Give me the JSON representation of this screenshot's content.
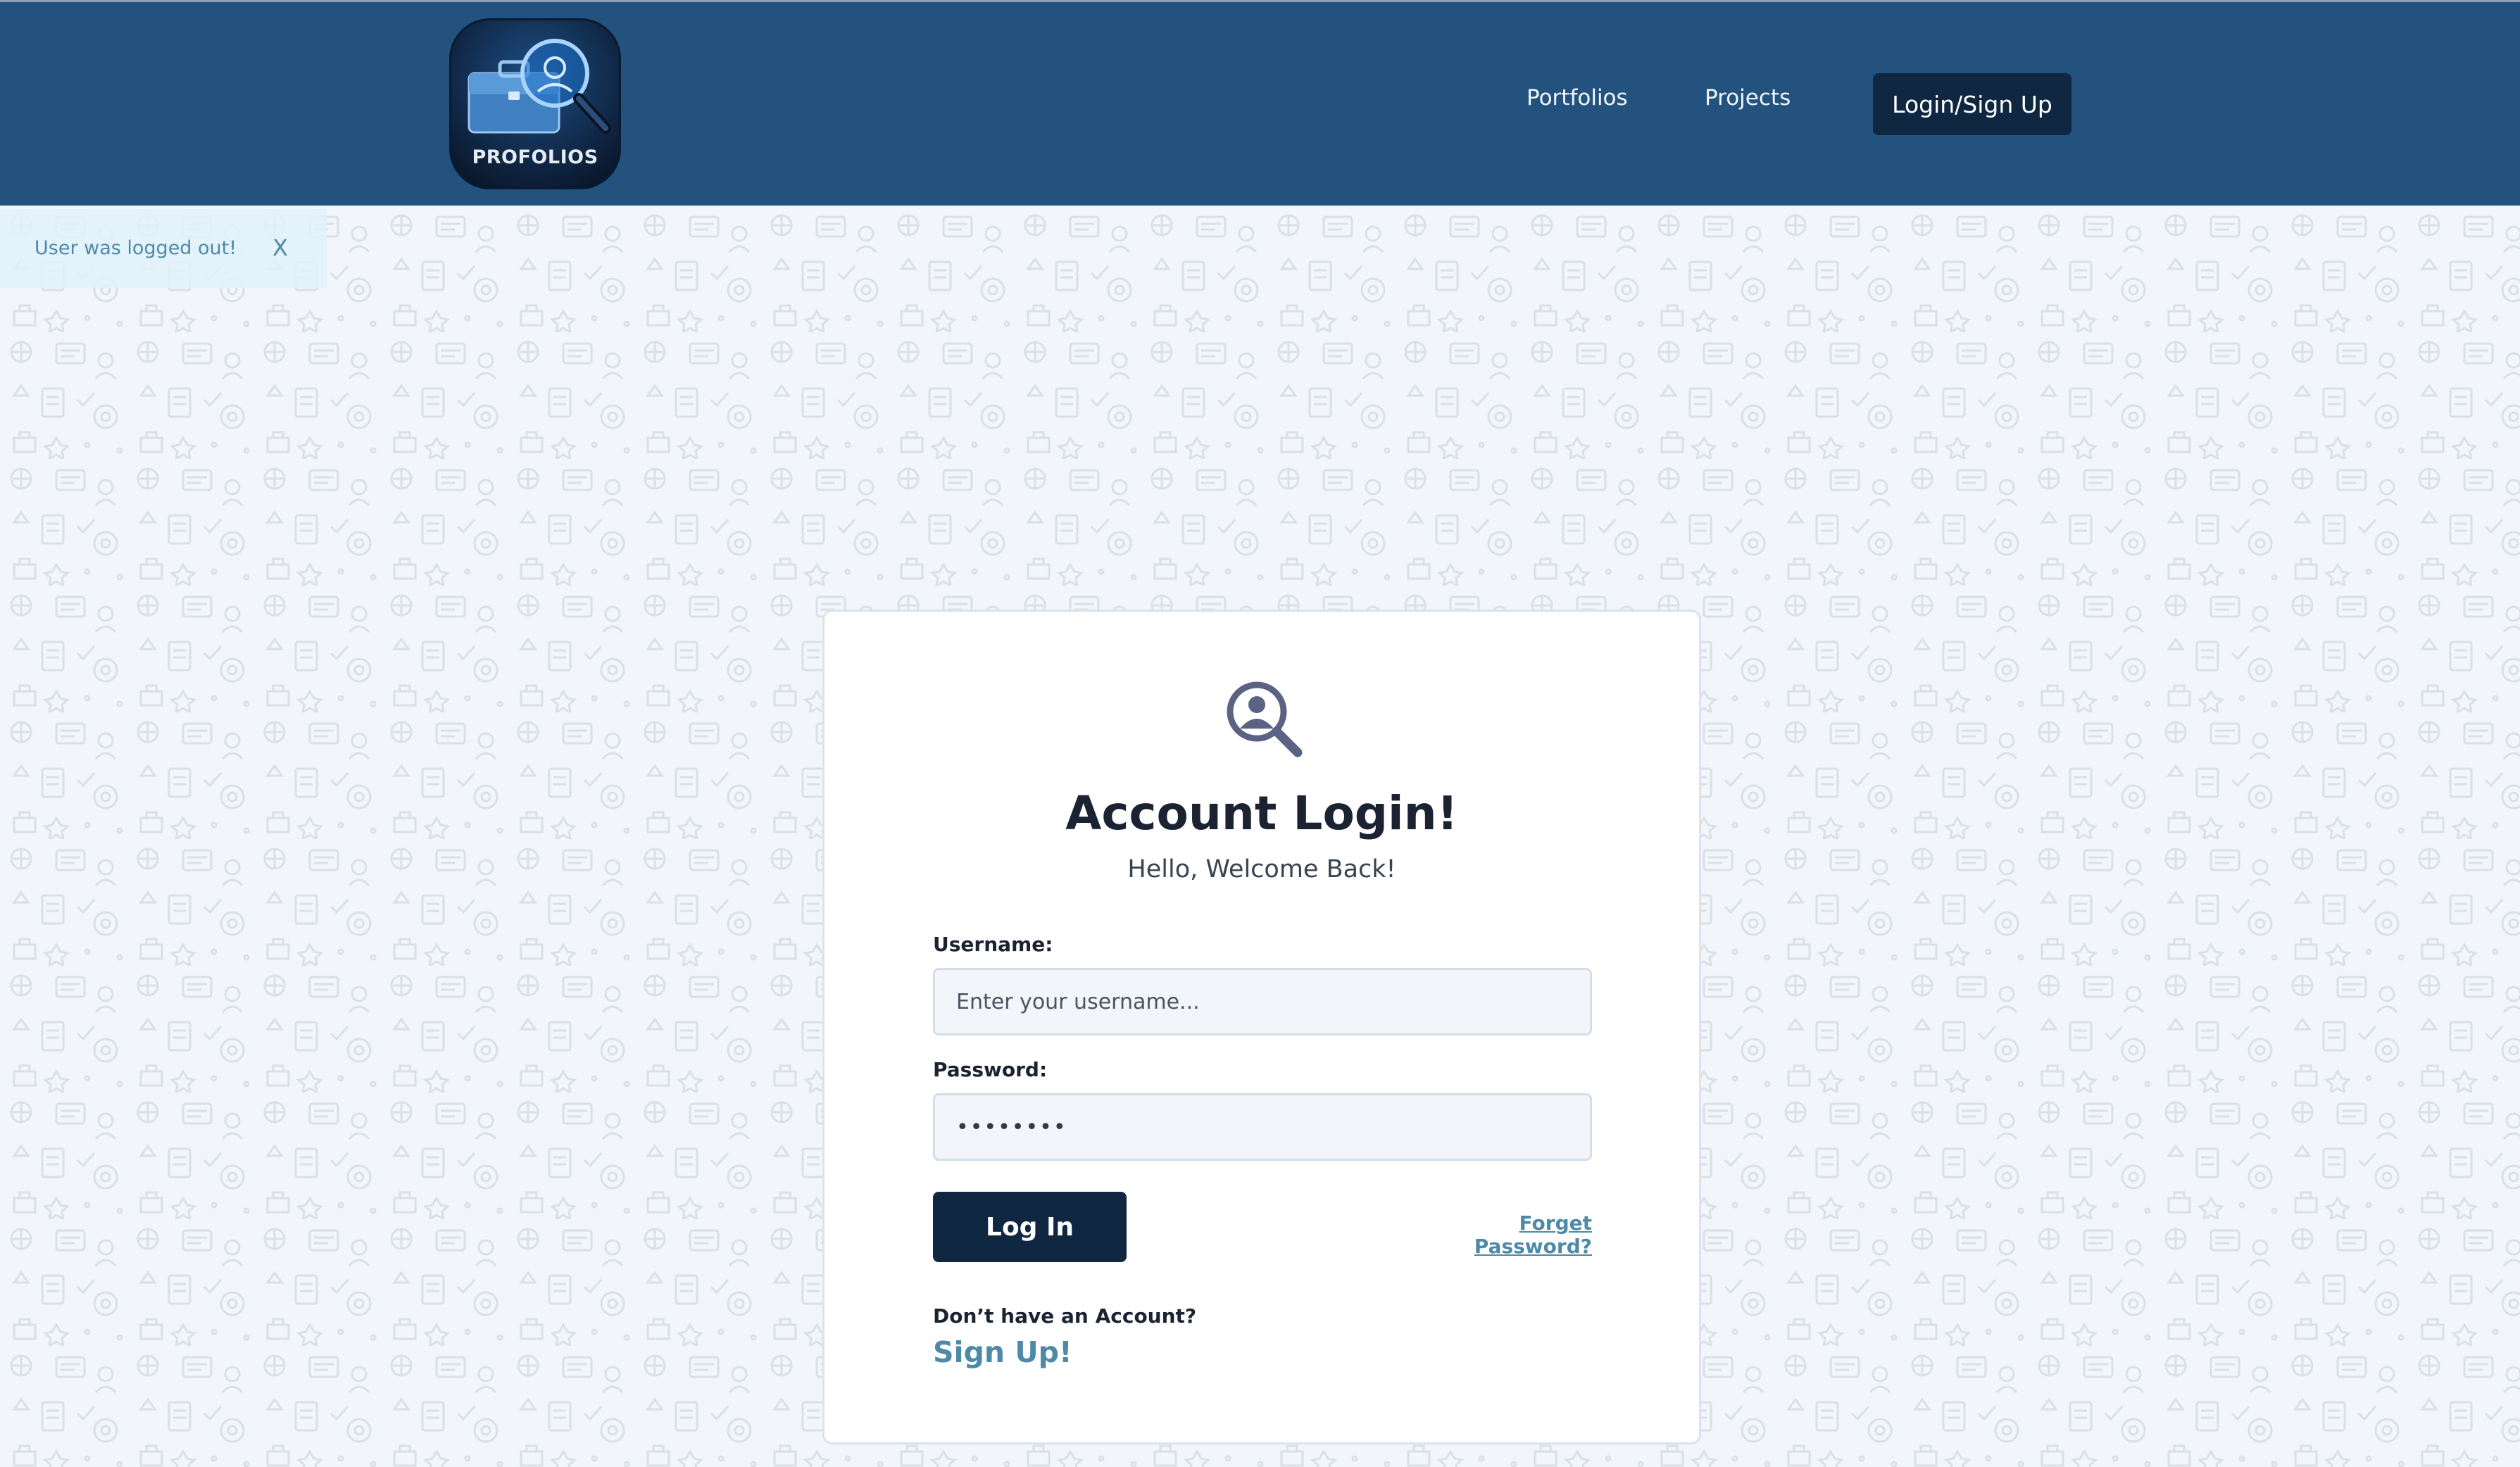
{
  "header": {
    "logo_text": "PROFOLIOS",
    "logo_icon": "briefcase-magnifier-icon",
    "nav": {
      "portfolios_label": "Portfolios",
      "projects_label": "Projects",
      "login_signup_label": "Login/Sign Up"
    }
  },
  "flash": {
    "message": "User was logged out!",
    "close_label": "X"
  },
  "login": {
    "icon": "user-search-icon",
    "title": "Account Login!",
    "subtitle": "Hello, Welcome Back!",
    "username_label": "Username:",
    "username_placeholder": "Enter your username...",
    "username_value": "",
    "password_label": "Password:",
    "password_value": "••••••••",
    "submit_label": "Log In",
    "forgot_label": "Forget Password?",
    "no_account_text": "Don’t have an Account?",
    "signup_label": "Sign Up!"
  },
  "colors": {
    "header_bg": "#23527f",
    "button_dark": "#0f2741",
    "link_accent": "#4d89a8",
    "page_bg": "#f2f5f9"
  }
}
